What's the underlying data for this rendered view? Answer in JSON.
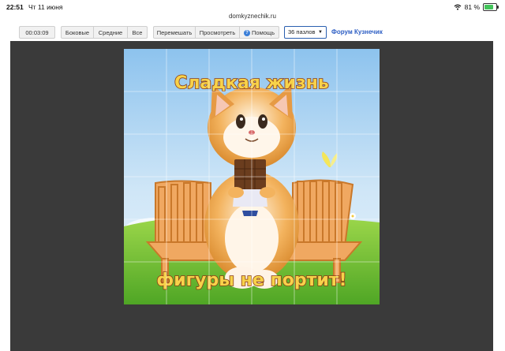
{
  "statusbar": {
    "time": "22:51",
    "date": "Чт 11 июня",
    "battery": "81 %",
    "battery_level": 0.81
  },
  "url": "domkyznechik.ru",
  "toolbar": {
    "timer": "00:03:09",
    "side_label": "Боковые",
    "middle_label": "Средние",
    "all_label": "Все",
    "shuffle_label": "Перемешать",
    "view_label": "Просмотреть",
    "help_label": "Помощь",
    "pieces_select": "36 пазлов",
    "forum_link": "Форум Кузнечик"
  },
  "puzzle": {
    "title_top": "Сладкая жизнь",
    "title_bottom": "фигуры не портит!",
    "grid": {
      "rows": 6,
      "cols": 6
    }
  }
}
